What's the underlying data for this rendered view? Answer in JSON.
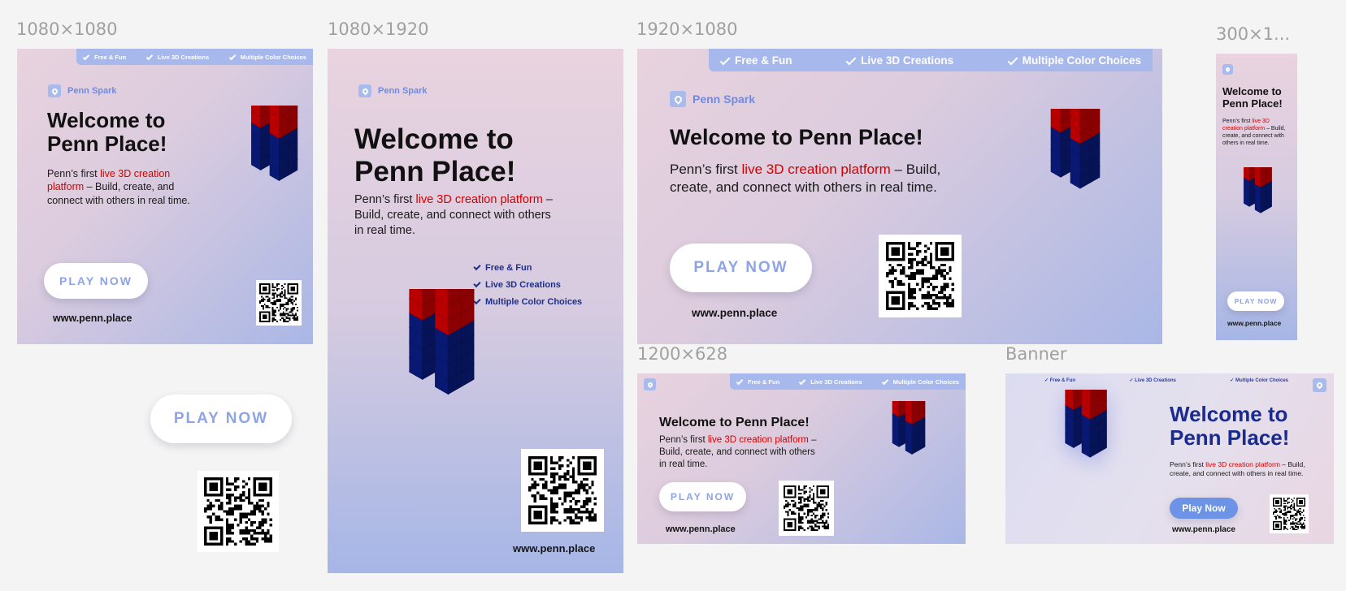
{
  "frames": {
    "square": {
      "label": "1080×1080"
    },
    "story": {
      "label": "1080×1920"
    },
    "landscape": {
      "label": "1920×1080"
    },
    "skyscraper": {
      "label": "300×1..."
    },
    "link": {
      "label": "1200×628"
    },
    "banner": {
      "label": "Banner"
    }
  },
  "features": {
    "free": "Free & Fun",
    "live3d": "Live 3D Creations",
    "colors": "Multiple Color Choices"
  },
  "brand": {
    "name": "Penn Spark"
  },
  "headline": "Welcome to Penn Place!",
  "description": {
    "prefix": "Penn’s first ",
    "highlight": "live 3D creation platform",
    "suffix": " – Build, create, and connect with others in real time."
  },
  "cta": {
    "label": "PLAY NOW",
    "label_banner": "Play Now"
  },
  "url": "www.penn.place",
  "colors": {
    "accent_red": "#d40000",
    "ribbon": "#a7b8ec",
    "brand_blue": "#6f8be0",
    "navy": "#1e2f8a",
    "cube_red": "#e00000",
    "cube_blue": "#0b1f8c"
  }
}
